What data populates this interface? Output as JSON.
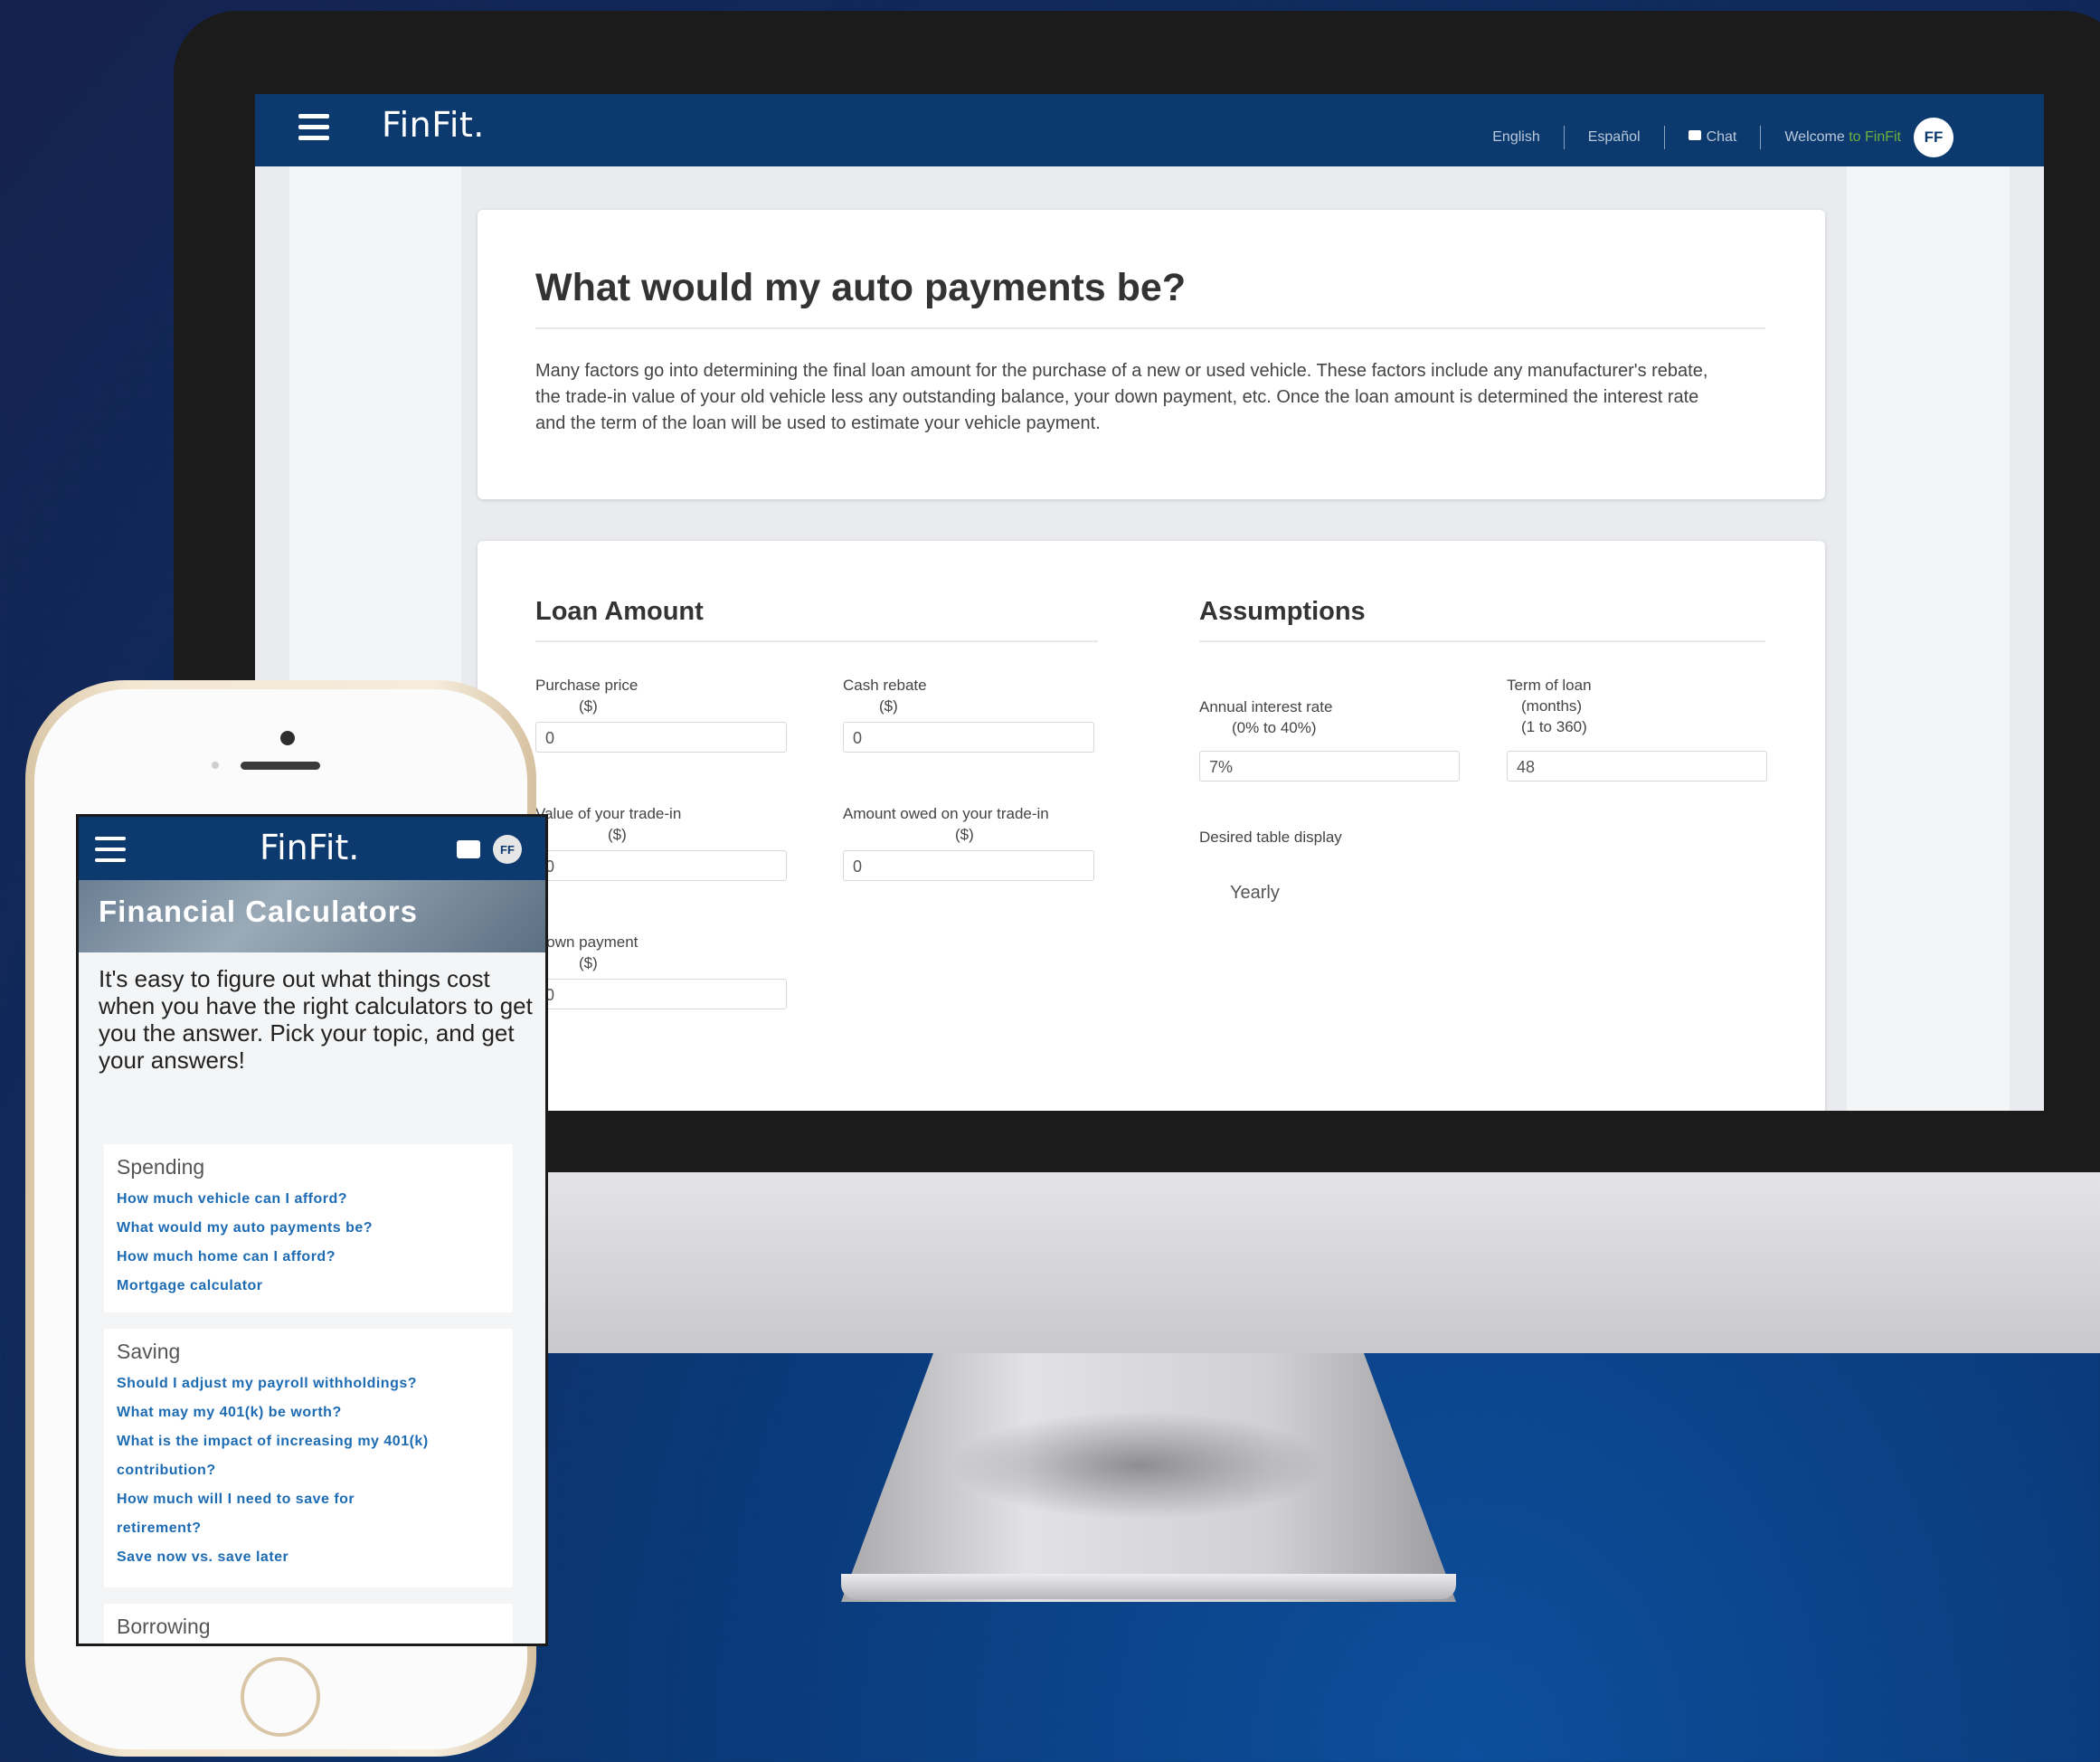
{
  "desktop": {
    "brand": "FinFit.",
    "nav": {
      "english": "English",
      "espanol": "Español",
      "chat": "Chat",
      "welcome_prefix": "Welcome",
      "welcome_brand": "to FinFit",
      "avatar": "FF"
    },
    "page": {
      "title": "What would my auto payments be?",
      "intro": "Many factors go into determining the final loan amount for the purchase of a new or used vehicle. These factors include any manufacturer's rebate, the trade-in value of your old vehicle less any outstanding balance, your down payment, etc. Once the loan amount is determined the interest rate and the term of the loan will be used to estimate your vehicle payment."
    },
    "loan_amount": {
      "heading": "Loan Amount",
      "purchase_price": {
        "label": "Purchase price",
        "unit": "($)",
        "value": "0"
      },
      "cash_rebate": {
        "label": "Cash rebate",
        "unit": "($)",
        "value": "0"
      },
      "trade_in_value": {
        "label": "Value of your trade-in",
        "unit": "($)",
        "value": "0"
      },
      "amount_owed": {
        "label": "Amount owed on your trade-in",
        "unit": "($)",
        "value": "0"
      },
      "down_payment": {
        "label": "Down payment",
        "unit": "($)",
        "value": "0"
      }
    },
    "assumptions": {
      "heading": "Assumptions",
      "interest_rate": {
        "label": "Annual interest rate",
        "range": "(0% to 40%)",
        "value": "7%"
      },
      "term": {
        "label": "Term of loan",
        "unit": "(months)",
        "range": "(1 to 360)",
        "value": "48"
      },
      "table_display": {
        "label": "Desired table display",
        "value": "Yearly"
      }
    }
  },
  "mobile": {
    "brand": "FinFit.",
    "avatar": "FF",
    "hero_title": "Financial Calculators",
    "intro": "It's easy to figure out what things cost when you have the right calculators to get you the answer. Pick your topic, and get your answers!",
    "sections": [
      {
        "title": "Spending",
        "links": [
          "How much vehicle can I afford?",
          "What would my auto payments be?",
          "How much home can I afford?",
          "Mortgage calculator"
        ]
      },
      {
        "title": "Saving",
        "links": [
          "Should I adjust my payroll withholdings?",
          "What may my 401(k) be worth?",
          "What is the impact of increasing my 401(k)",
          "contribution?",
          "How much will I need to save for",
          "retirement?",
          "Save now vs. save later"
        ]
      },
      {
        "title": "Borrowing",
        "links": []
      }
    ]
  },
  "colors": {
    "navbar": "#0c3a6e",
    "link": "#1d6bb3",
    "welcome_brand": "#6fae3d",
    "background": "#0f2a5c"
  }
}
